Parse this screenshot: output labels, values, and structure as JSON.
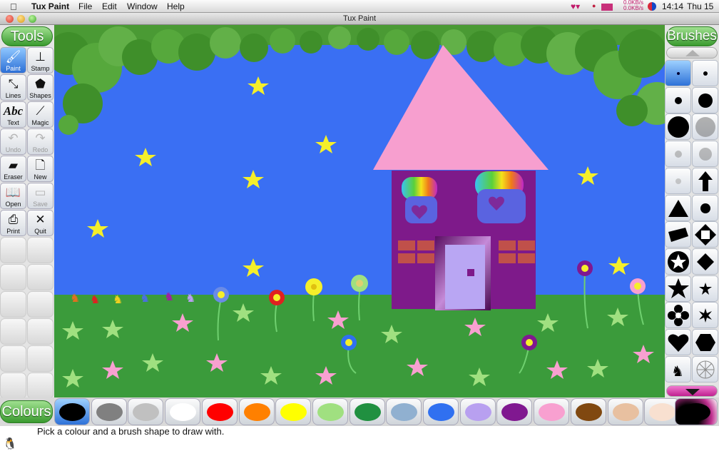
{
  "menubar": {
    "apple_icon": "apple-logo-icon",
    "app_name": "Tux Paint",
    "menus": [
      "File",
      "Edit",
      "Window",
      "Help"
    ],
    "net_up": "0.0KB/s",
    "net_down": "0.0KB/s",
    "time": "14:14",
    "day": "Thu 15"
  },
  "window": {
    "title": "Tux Paint"
  },
  "tools_panel": {
    "header": "Tools",
    "tools": [
      {
        "label": "Paint",
        "icon": "paintbrush-icon",
        "enabled": true,
        "selected": true
      },
      {
        "label": "Stamp",
        "icon": "stamp-icon",
        "enabled": true,
        "selected": false
      },
      {
        "label": "Lines",
        "icon": "lines-icon",
        "enabled": true,
        "selected": false
      },
      {
        "label": "Shapes",
        "icon": "pentagon-icon",
        "enabled": true,
        "selected": false
      },
      {
        "label": "Text",
        "icon": "text-abc-icon",
        "enabled": true,
        "selected": false
      },
      {
        "label": "Magic",
        "icon": "magic-wand-icon",
        "enabled": true,
        "selected": false
      },
      {
        "label": "Undo",
        "icon": "undo-icon",
        "enabled": false,
        "selected": false
      },
      {
        "label": "Redo",
        "icon": "redo-icon",
        "enabled": false,
        "selected": false
      },
      {
        "label": "Eraser",
        "icon": "eraser-icon",
        "enabled": true,
        "selected": false
      },
      {
        "label": "New",
        "icon": "new-page-icon",
        "enabled": true,
        "selected": false
      },
      {
        "label": "Open",
        "icon": "open-book-icon",
        "enabled": true,
        "selected": false
      },
      {
        "label": "Save",
        "icon": "save-icon",
        "enabled": false,
        "selected": false
      },
      {
        "label": "Print",
        "icon": "printer-icon",
        "enabled": true,
        "selected": false
      },
      {
        "label": "Quit",
        "icon": "quit-x-icon",
        "enabled": true,
        "selected": false
      }
    ]
  },
  "brushes_panel": {
    "header": "Brushes",
    "brushes": [
      "small-dot-brush-icon",
      "small-dot-brush-icon",
      "medium-dot-brush-icon",
      "large-dot-brush-icon",
      "huge-dot-brush-icon",
      "fuzzy-large-brush-icon",
      "fuzzy-small-brush-icon",
      "fuzzy-medium-brush-icon",
      "fuzzy-tiny-brush-icon",
      "up-arrow-brush-icon",
      "triangle-brush-icon",
      "circle-brush-icon",
      "diamond-brush-icon",
      "square-diamond-brush-icon",
      "star-circle-brush-icon",
      "diamond-small-brush-icon",
      "star-brush-icon",
      "small-star-brush-icon",
      "flower-brush-icon",
      "asterisk-brush-icon",
      "heart-brush-icon",
      "hexagon-brush-icon",
      "cat-brush-icon",
      "net-brush-icon"
    ],
    "selected_index": 0
  },
  "colours_panel": {
    "header": "Colours",
    "colors": [
      "#000000",
      "#808080",
      "#c0c0c0",
      "#ffffff",
      "#ff0000",
      "#ff8000",
      "#ffff00",
      "#a0e080",
      "#209040",
      "#90b0d0",
      "#3070f0",
      "#b8a0f0",
      "#801890",
      "#f8a0d0",
      "#804810",
      "#e8c0a0",
      "#f8e0d0"
    ],
    "selected_index": 0
  },
  "status": {
    "message": "Pick a colour and a brush shape to draw with.",
    "tux_icon": "tux-penguin-icon"
  },
  "drawing": {
    "sky_color": "#3a6ff3",
    "grass_color": "#3b9b3b",
    "roof_color": "#f79fcf",
    "house_color": "#7e1a8a",
    "door_color": "#b9a6f3"
  }
}
